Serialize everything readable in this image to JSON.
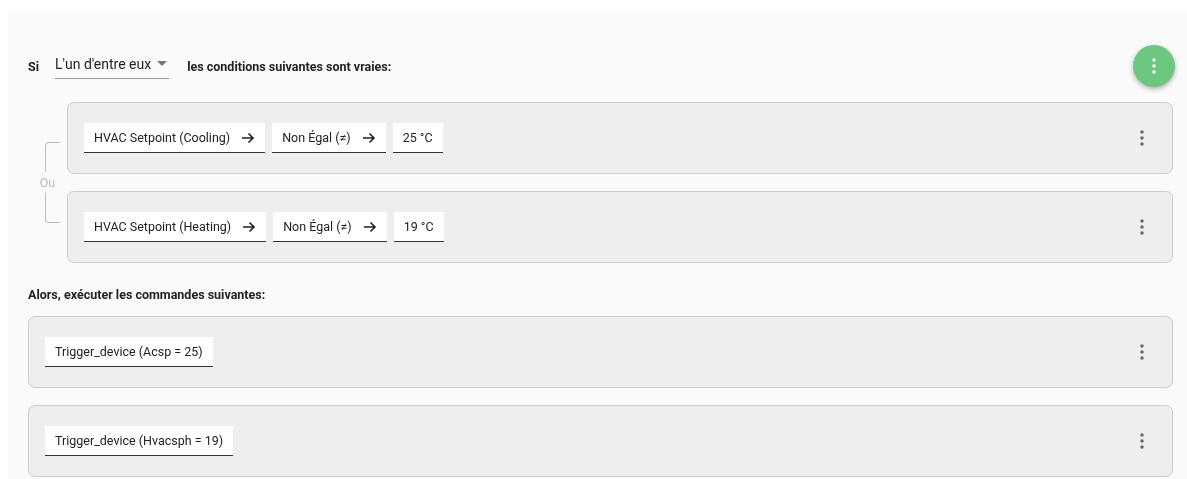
{
  "header": {
    "prefix": "Si",
    "match_mode": "L'un d'entre eux",
    "suffix": "les conditions suivantes sont vraies:"
  },
  "connector": "Ou",
  "conditions": [
    {
      "parts": [
        "HVAC Setpoint (Cooling)",
        "Non Égal (≠)",
        "25 °C"
      ]
    },
    {
      "parts": [
        "HVAC Setpoint (Heating)",
        "Non Égal (≠)",
        "19 °C"
      ]
    }
  ],
  "actions_heading": "Alors, exécuter les commandes suivantes:",
  "commands": [
    {
      "label": "Trigger_device (Acsp = 25)"
    },
    {
      "label": "Trigger_device (Hvacsph = 19)"
    }
  ]
}
